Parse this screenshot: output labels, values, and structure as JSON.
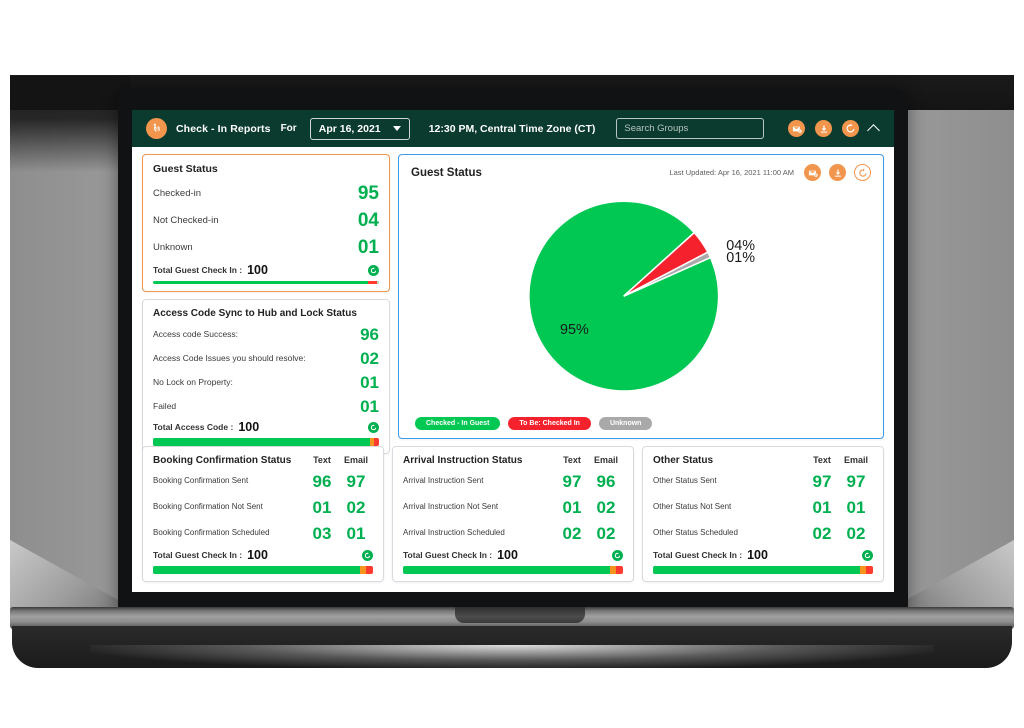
{
  "header": {
    "logo_icon": "app-logo-icon",
    "title": "Check - In Reports",
    "for_label": "For",
    "date_value": "Apr 16, 2021",
    "time_zone": "12:30 PM, Central Time Zone (CT)",
    "search_placeholder": "Search Groups",
    "search_value": "",
    "icons": [
      "email-icon",
      "download-icon",
      "refresh-icon",
      "chevron-up-icon"
    ]
  },
  "guest_status_card": {
    "title": "Guest Status",
    "rows": [
      {
        "label": "Checked-in",
        "value": "95"
      },
      {
        "label": "Not Checked-in",
        "value": "04"
      },
      {
        "label": "Unknown",
        "value": "01"
      }
    ],
    "total_label": "Total Guest Check In :",
    "total_value": "100",
    "bar": [
      {
        "color": "#00c853",
        "pct": 95
      },
      {
        "color": "#ff3b30",
        "pct": 4
      },
      {
        "color": "#c9c9c9",
        "pct": 1
      }
    ]
  },
  "access_code_card": {
    "title": "Access Code Sync to Hub and Lock Status",
    "rows": [
      {
        "label": "Access code Success:",
        "value": "96"
      },
      {
        "label": "Access Code Issues you should resolve:",
        "value": "02"
      },
      {
        "label": "No Lock on Property:",
        "value": "01"
      },
      {
        "label": "Failed",
        "value": "01"
      }
    ],
    "total_label": "Total Access Code :",
    "total_value": "100",
    "bar": [
      {
        "color": "#00c853",
        "pct": 96
      },
      {
        "color": "#f7941e",
        "pct": 2
      },
      {
        "color": "#ff3b30",
        "pct": 2
      }
    ]
  },
  "pie_panel": {
    "title": "Guest Status",
    "last_updated": "Last Updated: Apr 16, 2021 11:00 AM",
    "icons": [
      "email-icon",
      "download-icon",
      "refresh-icon"
    ],
    "legend": [
      {
        "label": "Checked - In Guest",
        "color": "#00c853"
      },
      {
        "label": "To Be: Checked In",
        "color": "#f5222d"
      },
      {
        "label": "Unknown",
        "color": "#a9a9a9"
      }
    ]
  },
  "chart_data": {
    "type": "pie",
    "title": "Guest Status",
    "labels": [
      "Checked - In Guest",
      "To Be: Checked In",
      "Unknown"
    ],
    "values": [
      95,
      4,
      1
    ],
    "display_labels": [
      "95%",
      "04%",
      "01%"
    ],
    "colors": [
      "#00c853",
      "#f5222d",
      "#a9a9a9"
    ],
    "legend_position": "bottom-left",
    "start_angle_deg": -24,
    "units": "percent"
  },
  "bottom_cards": [
    {
      "title": "Booking Confirmation Status",
      "col_text": "Text",
      "col_email": "Email",
      "rows": [
        {
          "label": "Booking Confirmation Sent",
          "text": "96",
          "email": "97"
        },
        {
          "label": "Booking Confirmation Not Sent",
          "text": "01",
          "email": "02"
        },
        {
          "label": "Booking Confirmation Scheduled",
          "text": "03",
          "email": "01"
        }
      ],
      "total_label": "Total Guest Check In :",
      "total_value": "100",
      "bar": [
        {
          "color": "#00c853",
          "pct": 94
        },
        {
          "color": "#f7941e",
          "pct": 3
        },
        {
          "color": "#ff3b30",
          "pct": 3
        }
      ]
    },
    {
      "title": "Arrival Instruction Status",
      "col_text": "Text",
      "col_email": "Email",
      "rows": [
        {
          "label": "Arrival Instruction Sent",
          "text": "97",
          "email": "96"
        },
        {
          "label": "Arrival Instruction Not Sent",
          "text": "01",
          "email": "02"
        },
        {
          "label": "Arrival Instruction Scheduled",
          "text": "02",
          "email": "02"
        }
      ],
      "total_label": "Total Guest Check In :",
      "total_value": "100",
      "bar": [
        {
          "color": "#00c853",
          "pct": 94
        },
        {
          "color": "#f7941e",
          "pct": 3
        },
        {
          "color": "#ff3b30",
          "pct": 3
        }
      ]
    },
    {
      "title": "Other Status",
      "col_text": "Text",
      "col_email": "Email",
      "rows": [
        {
          "label": "Other Status Sent",
          "text": "97",
          "email": "97"
        },
        {
          "label": "Other Status Not Sent",
          "text": "01",
          "email": "01"
        },
        {
          "label": "Other Status Scheduled",
          "text": "02",
          "email": "02"
        }
      ],
      "total_label": "Total Guest Check In :",
      "total_value": "100",
      "bar": [
        {
          "color": "#00c853",
          "pct": 94
        },
        {
          "color": "#f7941e",
          "pct": 3
        },
        {
          "color": "#ff3b30",
          "pct": 3
        }
      ]
    }
  ],
  "colors": {
    "header_bg": "#0b3b2e",
    "accent_orange": "#f2954d",
    "accent_blue": "#3d9be9",
    "value_green": "#00b050",
    "pie_green": "#00c853",
    "pie_red": "#f5222d",
    "pie_gray": "#a9a9a9"
  }
}
